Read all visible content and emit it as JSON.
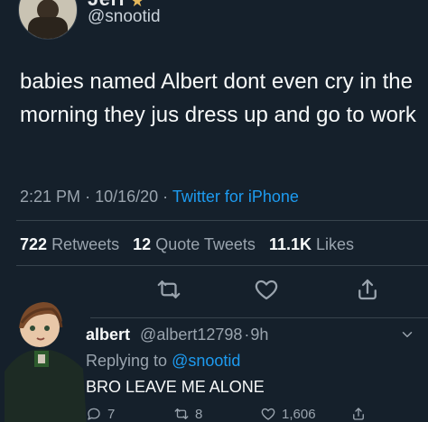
{
  "header": {
    "display_name": "Jerr",
    "handle": "@snootid"
  },
  "tweet": {
    "text": "babies named Albert dont even cry in the morning they jus dress up and go to work",
    "time": "2:21 PM",
    "date": "10/16/20",
    "source": "Twitter for iPhone",
    "retweets_count": "722",
    "retweets_label": "Retweets",
    "quote_tweets_count": "12",
    "quote_tweets_label": "Quote Tweets",
    "likes_count": "11.1K",
    "likes_label": "Likes"
  },
  "reply": {
    "name": "albert",
    "handle": "@albert12798",
    "age": "9h",
    "replying_to_prefix": "Replying to",
    "replying_to_handle": "@snootid",
    "text": "BRO LEAVE ME ALONE",
    "reply_count": "7",
    "retweet_count": "8",
    "like_count": "1,606"
  },
  "colors": {
    "background": "#15202b",
    "text": "#e7e9ea",
    "muted": "#9aa4ae",
    "accent": "#1d9bf0"
  },
  "icons": {
    "reply": "speech-bubble-icon",
    "retweet": "retweet-icon",
    "like": "heart-icon",
    "share": "share-icon",
    "more": "chevron-down-icon"
  }
}
